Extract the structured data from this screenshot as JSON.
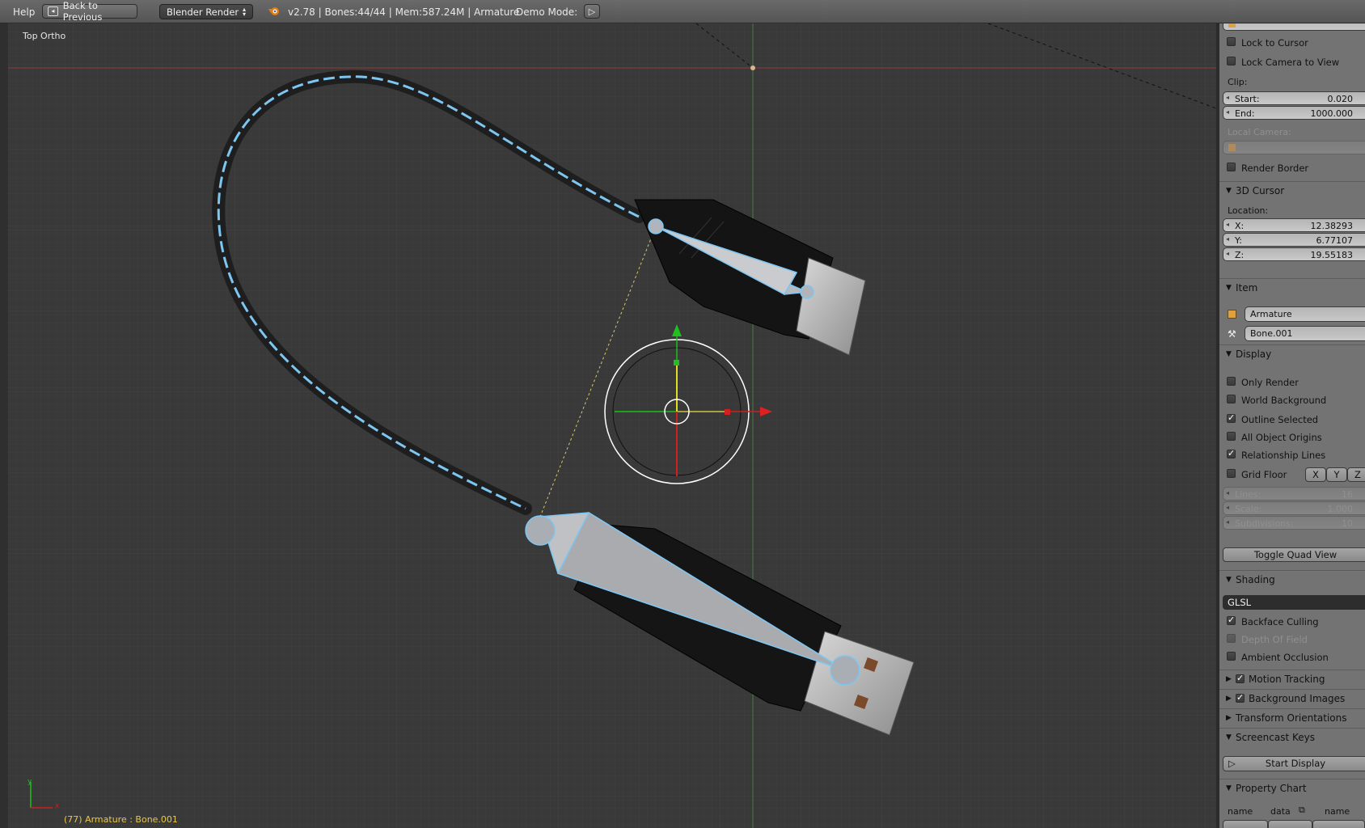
{
  "topbar": {
    "help": "Help",
    "back_button": "Back to Previous",
    "render_engine": "Blender Render",
    "status": "v2.78 | Bones:44/44  | Mem:587.24M | Armature",
    "demo_mode": "Demo Mode:"
  },
  "viewport": {
    "view_name": "Top Ortho",
    "status_text": "(77) Armature : Bone.001",
    "axis_x": "x",
    "axis_y": "y"
  },
  "panel": {
    "lock_to_cursor": "Lock to Cursor",
    "lock_camera": "Lock Camera to View",
    "clip_label": "Clip:",
    "clip_start_label": "Start:",
    "clip_start_value": "0.020",
    "clip_end_label": "End:",
    "clip_end_value": "1000.000",
    "local_camera_label": "Local Camera:",
    "render_border": "Render Border",
    "cursor_header": "3D Cursor",
    "location_label": "Location:",
    "cursor_x_label": "X:",
    "cursor_x": "12.38293",
    "cursor_y_label": "Y:",
    "cursor_y": "6.77107",
    "cursor_z_label": "Z:",
    "cursor_z": "19.55183",
    "item_header": "Item",
    "item_object": "Armature",
    "item_bone": "Bone.001",
    "display_header": "Display",
    "only_render": "Only Render",
    "world_background": "World Background",
    "outline_selected": "Outline Selected",
    "all_object_origins": "All Object Origins",
    "relationship_lines": "Relationship Lines",
    "grid_floor": "Grid Floor",
    "axis_x": "X",
    "axis_y": "Y",
    "axis_z": "Z",
    "lines_label": "Lines:",
    "lines_value": "16",
    "scale_label": "Scale:",
    "scale_value": "1.000",
    "subdiv_label": "Subdivisions:",
    "subdiv_value": "10",
    "toggle_quad": "Toggle Quad View",
    "shading_header": "Shading",
    "shading_mode": "GLSL",
    "backface_culling": "Backface Culling",
    "depth_of_field": "Depth Of Field",
    "ambient_occlusion": "Ambient Occlusion",
    "motion_tracking": "Motion Tracking",
    "background_images": "Background Images",
    "transform_orientations": "Transform Orientations",
    "screencast_header": "Screencast Keys",
    "start_display": "Start Display",
    "property_chart_header": "Property Chart",
    "pc_name1": "name",
    "pc_data": "data",
    "pc_name2": "name"
  },
  "checkboxes": {
    "lock_to_cursor": false,
    "lock_camera": false,
    "render_border": false,
    "only_render": false,
    "world_background": false,
    "outline_selected": true,
    "all_object_origins": false,
    "relationship_lines": true,
    "grid_floor": false,
    "backface_culling": true,
    "depth_of_field": false,
    "ambient_occlusion": false,
    "motion_tracking": true,
    "background_images": true
  },
  "colors": {
    "viewport_bg": "#393939",
    "panel_bg": "#737373",
    "bone_blue": "#7ec6f2",
    "status_yellow": "#e8c84a"
  }
}
